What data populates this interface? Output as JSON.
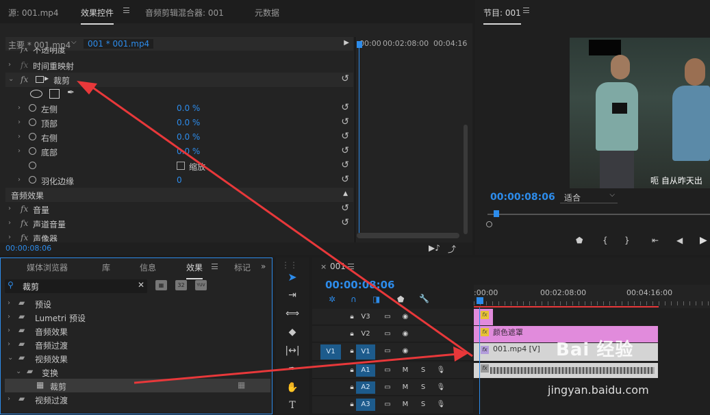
{
  "source_tab": "源: 001.mp4",
  "ec": {
    "tabs": [
      "效果控件",
      "音频剪辑混合器: 001",
      "元数据"
    ],
    "master_label": "主要 * 001.mp4",
    "clip_label": "001 * 001.mp4",
    "ruler": [
      "00:00",
      "00:02:08:00",
      "00:04:16"
    ],
    "rows": {
      "opacity": "不透明度",
      "time_remap": "时间重映射",
      "crop": "裁剪",
      "left": "左侧",
      "left_v": "0.0 %",
      "top": "顶部",
      "top_v": "0.0 %",
      "right": "右侧",
      "right_v": "0.0 %",
      "bottom": "底部",
      "bottom_v": "0.0 %",
      "zoom": "缩放",
      "feather": "羽化边缘",
      "feather_v": "0",
      "audio_section": "音频效果",
      "volume": "音量",
      "channel_volume": "声道音量",
      "panner": "声像器"
    },
    "fx": "fx",
    "timecode": "00:00:08:06"
  },
  "program": {
    "title": "节目: 001",
    "timecode": "00:00:08:06",
    "fit": "适合",
    "subtitle": "呃 自从昨天出"
  },
  "project": {
    "tabs": [
      "媒体浏览器",
      "库",
      "信息",
      "效果",
      "标记"
    ],
    "search_value": "裁剪",
    "badges": [
      "32",
      "YUV"
    ],
    "tree": [
      "预设",
      "Lumetri 预设",
      "音频效果",
      "音频过渡",
      "视频效果",
      "变换",
      "裁剪",
      "视频过渡"
    ]
  },
  "timeline": {
    "close": "×",
    "seq": "001",
    "timecode": "00:00:08:06",
    "ruler": [
      ":00:00",
      "00:02:08:00",
      "00:04:16:00"
    ],
    "tracks": {
      "v3": "V3",
      "v2": "V2",
      "v1": "V1",
      "v1src": "V1",
      "a1": "A1",
      "a2": "A2",
      "a3": "A3",
      "m": "M",
      "s": "S"
    },
    "clips": {
      "v2": "颜色遮罩",
      "v1": "001.mp4 [V]"
    },
    "fx": "fx"
  },
  "watermark": {
    "text": "Bai 经验",
    "url": "jingyan.baidu.com"
  },
  "colors": {
    "accent": "#2d8ceb",
    "clip_pink": "#e18bdc",
    "arrow": "#e8383a"
  }
}
